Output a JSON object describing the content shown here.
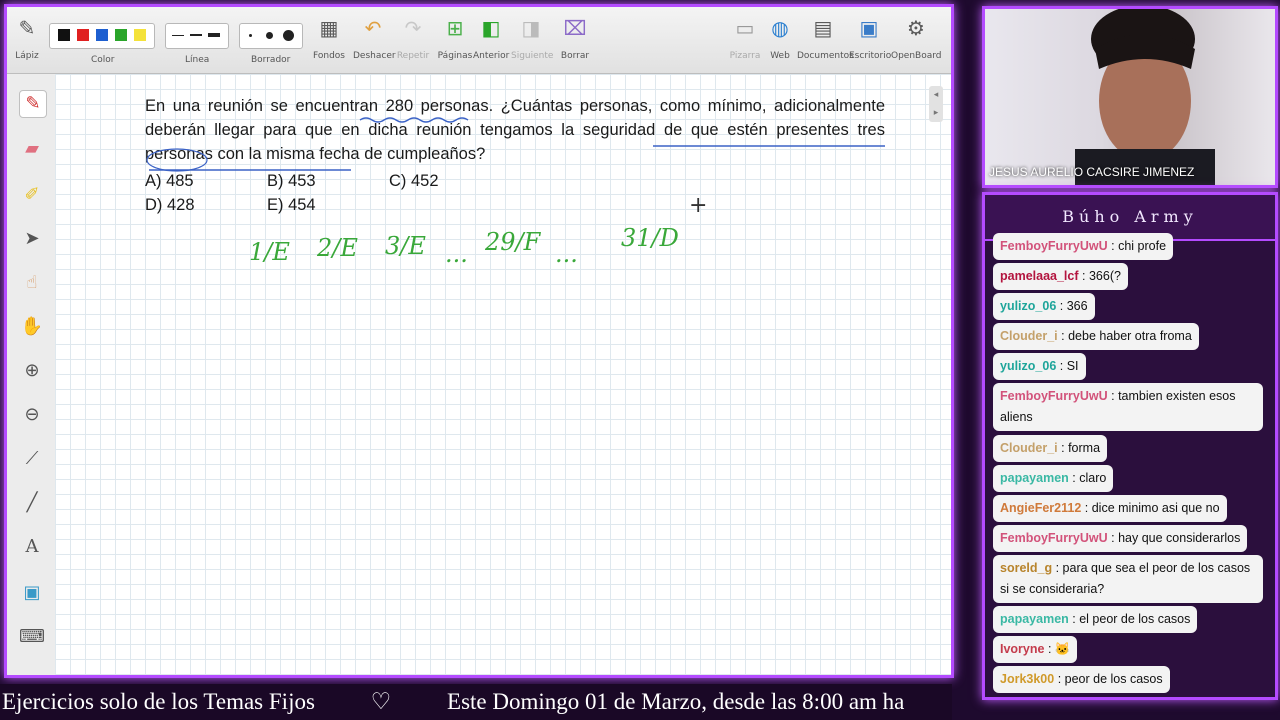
{
  "toolbar": {
    "lapiz": "Lápiz",
    "color": "Color",
    "linea": "Línea",
    "borrador": "Borrador",
    "fondos": "Fondos",
    "deshacer": "Deshacer",
    "repetir": "Repetir",
    "paginas": "Páginas",
    "anterior": "Anterior",
    "siguiente": "Siguiente",
    "borrar": "Borrar",
    "pizarra": "Pizarra",
    "web": "Web",
    "documentos": "Documentos",
    "escritorio": "Escritorio",
    "openboard": "OpenBoard",
    "colors": [
      "#111111",
      "#e02020",
      "#1d5fd0",
      "#2aa52a",
      "#f4e23a"
    ]
  },
  "board": {
    "question": "En una reunión se encuentran 280 personas. ¿Cuántas personas, como mínimo, adicionalmente deberán llegar para que en dicha reunión tengamos la seguridad de que estén presentes tres personas con la misma fecha de cumpleaños?",
    "options": {
      "a": "A) 485",
      "b": "B) 453",
      "c": "C) 452",
      "d": "D) 428",
      "e": "E) 454"
    },
    "handwriting": {
      "h1": "1/E",
      "h2": "2/E",
      "h3": "3/E",
      "dots1": "...",
      "h4": "29/F",
      "dots2": "...",
      "h5": "31/D"
    }
  },
  "webcam": {
    "caption": "JESUS AURELIO CACSIRE JIMENEZ"
  },
  "chat": {
    "title": "Búho Army",
    "messages": [
      {
        "user": "FemboyFurryUwU",
        "text": ": chi profe",
        "color": "#d2527a"
      },
      {
        "user": "pamelaaa_lcf",
        "text": ": 366(?",
        "color": "#b3143e"
      },
      {
        "user": "yulizo_06",
        "text": ": 366",
        "color": "#1fa59a"
      },
      {
        "user": "Clouder_i",
        "text": ": debe haber otra froma",
        "color": "#c4a06a"
      },
      {
        "user": "yulizo_06",
        "text": ": SI",
        "color": "#1fa59a"
      },
      {
        "user": "FemboyFurryUwU",
        "text": ": tambien existen esos aliens",
        "color": "#d2527a"
      },
      {
        "user": "Clouder_i",
        "text": ": forma",
        "color": "#c4a06a"
      },
      {
        "user": "papayamen",
        "text": ": claro",
        "color": "#3ab8a4"
      },
      {
        "user": "AngieFer2112",
        "text": ": dice minimo asi que no",
        "color": "#d07a3a"
      },
      {
        "user": "FemboyFurryUwU",
        "text": ": hay que considerarlos",
        "color": "#d2527a"
      },
      {
        "user": "soreld_g",
        "text": ": para que sea el peor de los casos si se consideraria?",
        "color": "#b8842c"
      },
      {
        "user": "papayamen",
        "text": ": el peor de los casos",
        "color": "#3ab8a4"
      },
      {
        "user": "Ivoryne",
        "text": ": 🐱",
        "color": "#c43c4c"
      },
      {
        "user": "Jork3k00",
        "text": ": peor de los casos",
        "color": "#d09a2a"
      }
    ]
  },
  "ticker": {
    "text1": "Ejercicios solo de los Temas Fijos",
    "heart": "♡",
    "text2": "Este Domingo 01 de Marzo, desde las 8:00 am ha"
  }
}
